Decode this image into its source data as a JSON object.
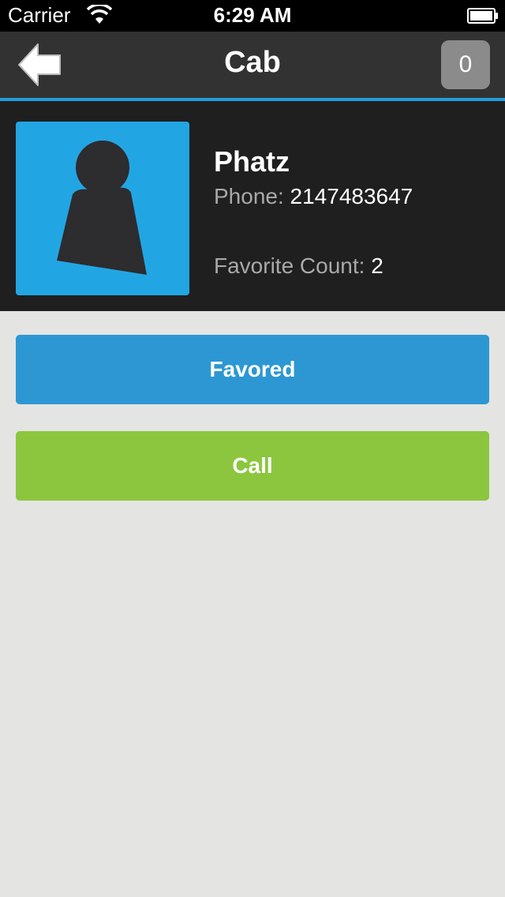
{
  "status_bar": {
    "carrier": "Carrier",
    "time": "6:29 AM",
    "icons": [
      "wifi-icon",
      "battery-icon"
    ]
  },
  "nav": {
    "back_icon": "back-arrow-icon",
    "title": "Cab",
    "badge_count": "0",
    "accent_color": "#1f9fe0"
  },
  "profile": {
    "avatar_icon": "person-silhouette-icon",
    "avatar_color": "#22a6e3",
    "name": "Phatz",
    "phone_label": "Phone:",
    "phone_value": "2147483647",
    "favorite_label": "Favorite Count:",
    "favorite_value": "2"
  },
  "actions": {
    "favored_label": "Favored",
    "favored_color": "#2d97d4",
    "call_label": "Call",
    "call_color": "#8cc63f"
  }
}
